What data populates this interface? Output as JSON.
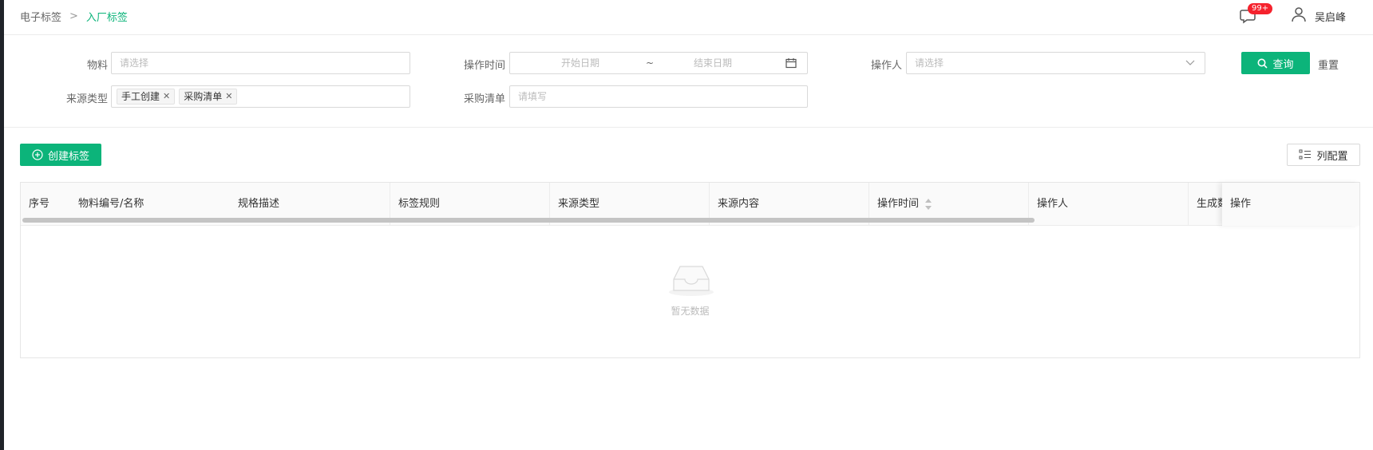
{
  "breadcrumb": {
    "root": "电子标签",
    "separator": ">",
    "current": "入厂标签"
  },
  "header": {
    "notification_badge": "99+",
    "user_name": "吴启峰"
  },
  "filters": {
    "material": {
      "label": "物料",
      "placeholder": "请选择"
    },
    "operate_time": {
      "label": "操作时间",
      "start_placeholder": "开始日期",
      "separator": "~",
      "end_placeholder": "结束日期"
    },
    "operator": {
      "label": "操作人",
      "placeholder": "请选择"
    },
    "source_type": {
      "label": "来源类型",
      "tags": [
        "手工创建",
        "采购清单"
      ]
    },
    "purchase_list": {
      "label": "采购清单",
      "placeholder": "请填写"
    },
    "query_label": "查询",
    "reset_label": "重置"
  },
  "toolbar": {
    "create_label": "创建标签",
    "column_config_label": "列配置"
  },
  "table": {
    "columns": [
      "序号",
      "物料编号/名称",
      "规格描述",
      "标签规则",
      "来源类型",
      "来源内容",
      "操作时间",
      "操作人",
      "生成数",
      "操作"
    ],
    "empty_text": "暂无数据"
  },
  "colors": {
    "accent": "#0cb47a",
    "badge": "#f5222d"
  }
}
